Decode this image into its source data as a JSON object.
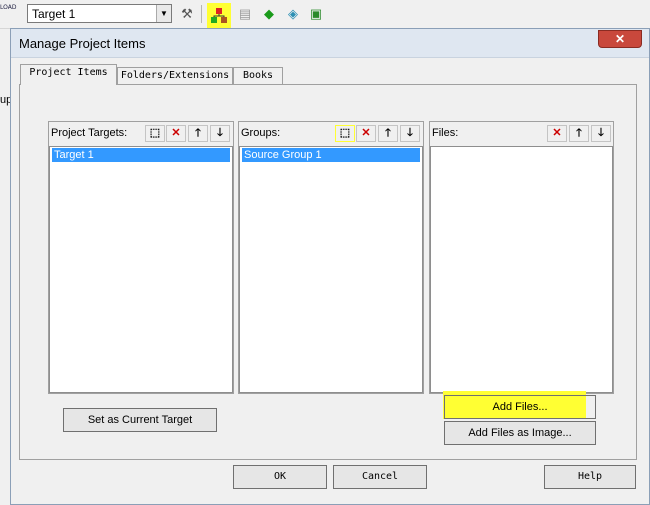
{
  "toolbar": {
    "load_icon_text": "LOAD",
    "target_select": {
      "value": "Target 1"
    },
    "icons": [
      "magic-wand-icon",
      "manage-project-items-icon",
      "select-pack-icon",
      "green-diamond-icon",
      "blue-diamond-icon",
      "book-diamond-icon"
    ]
  },
  "window_left_fragment": "up",
  "dialog": {
    "title": "Manage Project Items",
    "close_label": "✕",
    "tabs": [
      {
        "label": "Project Items",
        "active": true
      },
      {
        "label": "Folders/Extensions",
        "active": false
      },
      {
        "label": "Books",
        "active": false
      }
    ],
    "targets": {
      "label": "Project Targets:",
      "items": [
        "Target 1"
      ]
    },
    "groups": {
      "label": "Groups:",
      "items": [
        "Source Group 1"
      ]
    },
    "files": {
      "label": "Files:",
      "items": []
    },
    "set_current_target_label": "Set as Current Target",
    "add_files_label": "Add Files...",
    "add_files_image_label": "Add Files as Image...",
    "ok_label": "OK",
    "cancel_label": "Cancel",
    "help_label": "Help",
    "highlight_color": "#ffff33",
    "selection_color": "#3399ff"
  }
}
